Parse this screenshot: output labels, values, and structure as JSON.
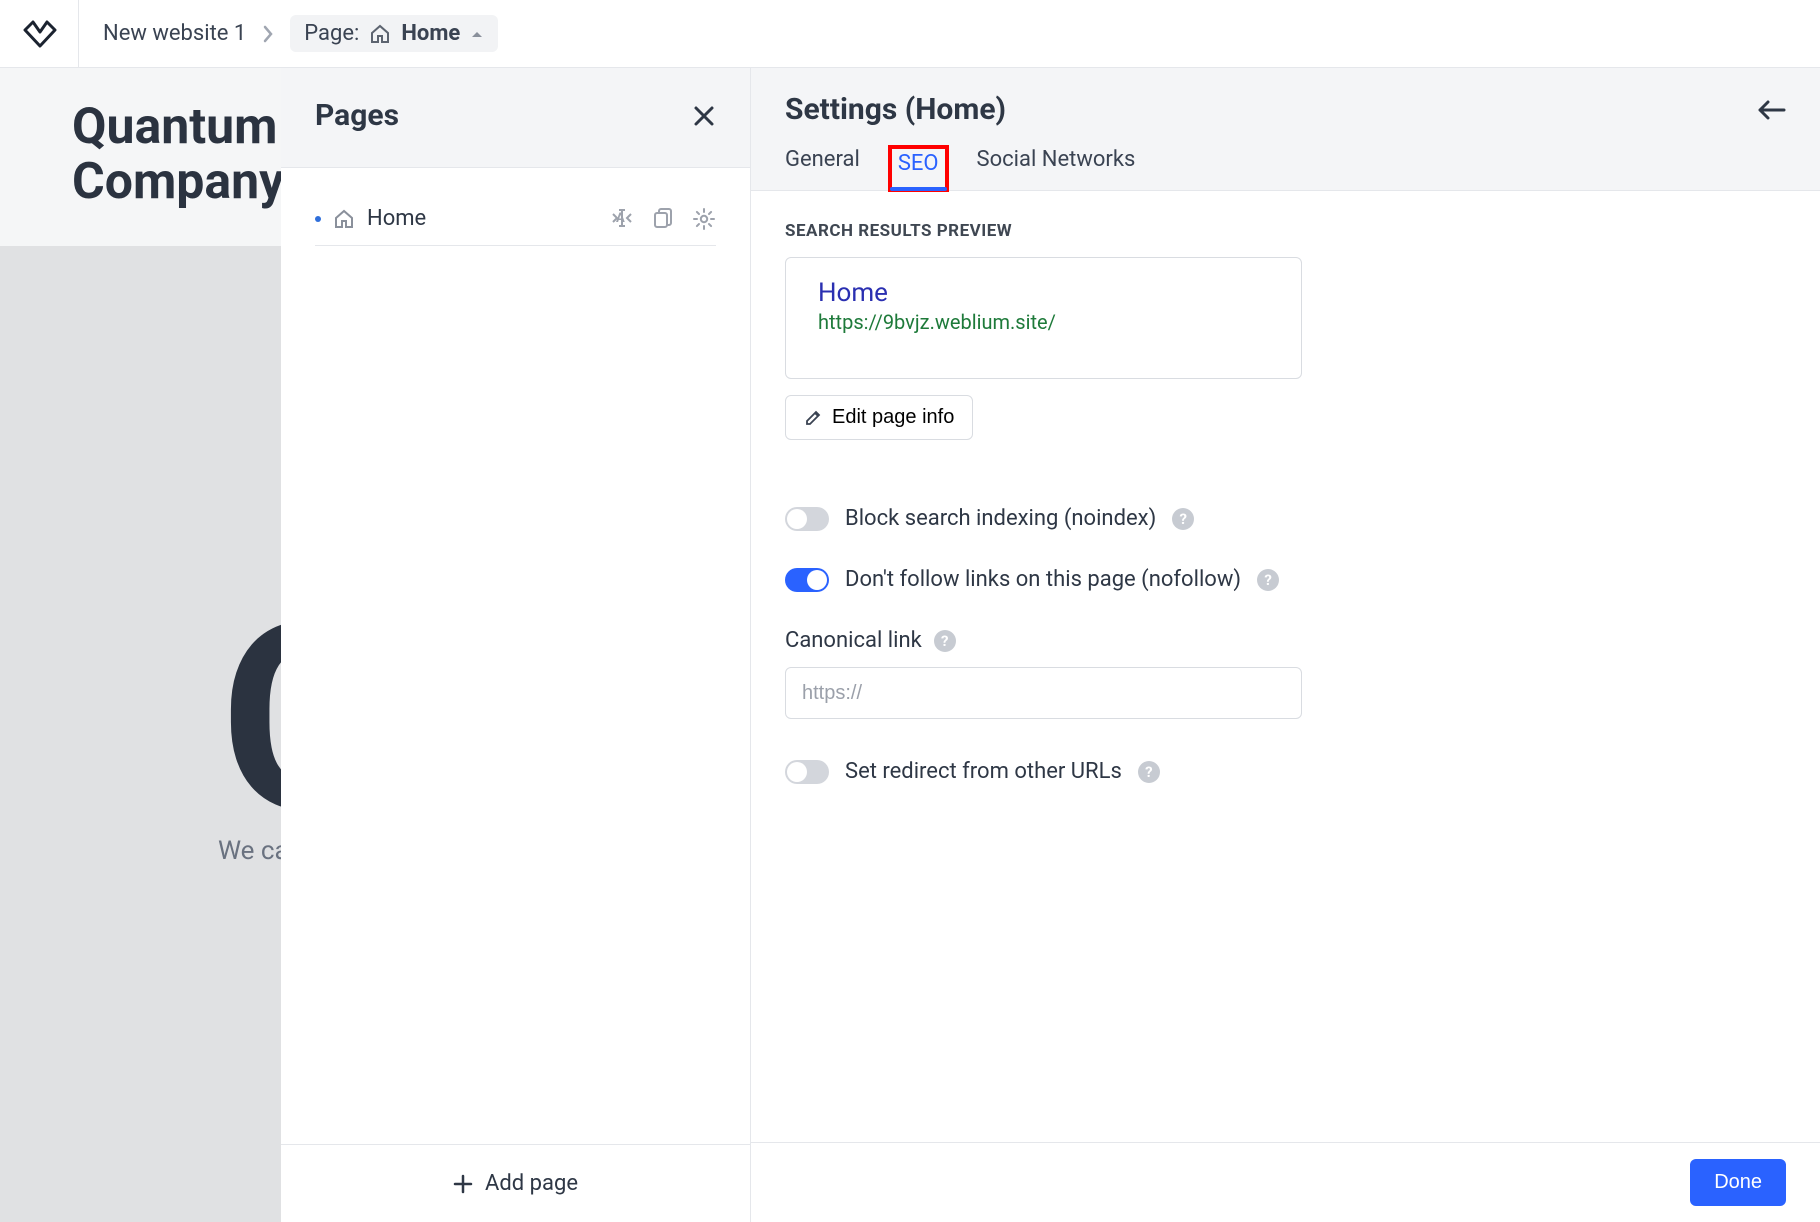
{
  "breadcrumb": {
    "site_name": "New website 1",
    "page_prefix": "Page:",
    "page_name": "Home"
  },
  "behind": {
    "hero_line1": "Quantum",
    "hero_line2": "Company",
    "big_letter": "C",
    "sub": "We ca"
  },
  "pages_panel": {
    "title": "Pages",
    "items": [
      {
        "label": "Home"
      }
    ],
    "add_page": "Add page"
  },
  "settings": {
    "title": "Settings (Home)",
    "tabs": {
      "general": "General",
      "seo": "SEO",
      "social": "Social Networks"
    },
    "preview_label": "SEARCH RESULTS PREVIEW",
    "preview": {
      "title": "Home",
      "url": "https://9bvjz.weblium.site/"
    },
    "edit_page_info": "Edit page info",
    "toggles": {
      "noindex": "Block search indexing (noindex)",
      "nofollow": "Don't follow links on this page (nofollow)",
      "redirect": "Set redirect from other URLs"
    },
    "canonical_label": "Canonical link",
    "canonical_placeholder": "https://",
    "done": "Done"
  },
  "icons": {
    "home": "home-icon",
    "close": "close-icon",
    "gear": "gear-icon",
    "duplicate": "duplicate-icon",
    "rename": "rename-icon",
    "pencil": "pencil-icon",
    "plus": "plus-icon",
    "back": "back-arrow-icon",
    "caret_up": "caret-up-icon",
    "chevron_right": "chevron-right-icon"
  }
}
